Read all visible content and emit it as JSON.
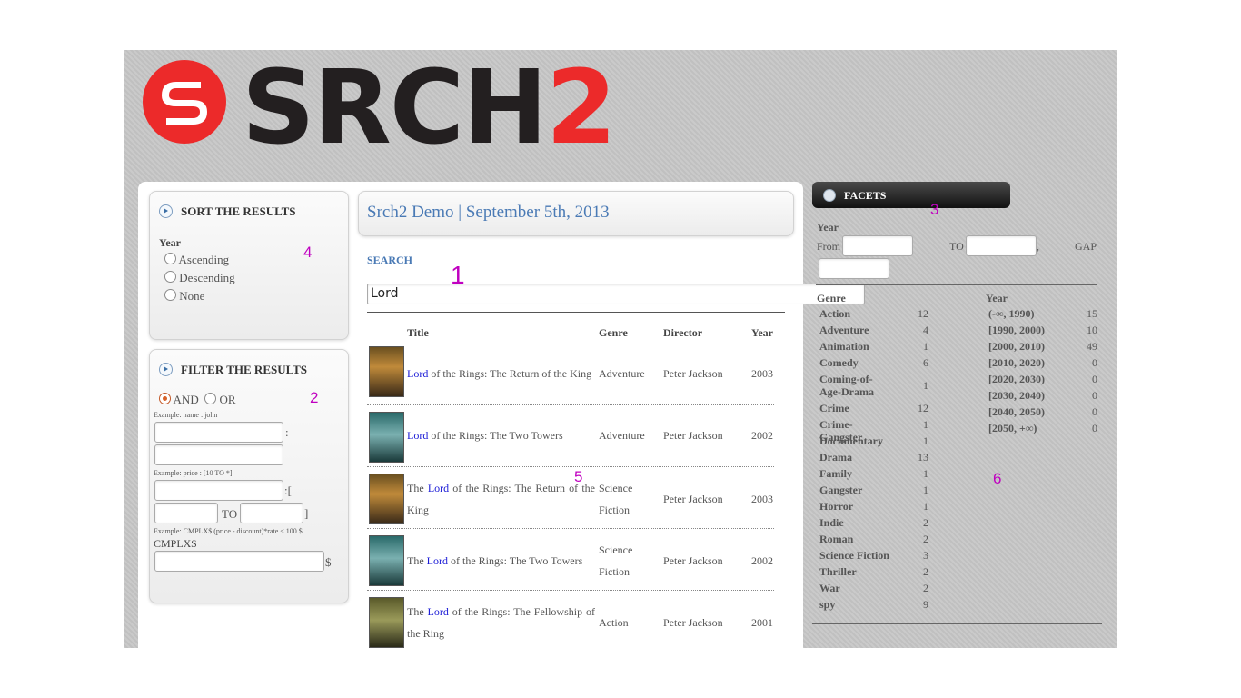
{
  "brand": {
    "logo_text": "SRCH",
    "logo_digit": "2",
    "colors": {
      "red": "#ec2a2a",
      "dark": "#231f20"
    }
  },
  "sort_panel": {
    "title": "SORT THE RESULTS",
    "field_label": "Year",
    "options": [
      "Ascending",
      "Descending",
      "None"
    ]
  },
  "filter_panel": {
    "title": "FILTER THE RESULTS",
    "and_label": "AND",
    "or_label": "OR",
    "example_name": "Example: name : john",
    "colon": ":",
    "example_price": "Example: price : [10 TO *]",
    "range_open": ":[",
    "to_label": "TO",
    "range_close": "]",
    "example_cmplx": "Example: CMPLX$ (price - discount)*rate < 100 $",
    "cmplx_label": "CMPLX$",
    "dollar": "$"
  },
  "main": {
    "header": "Srch2 Demo | September 5th, 2013",
    "search_label": "SEARCH",
    "search_value": "Lord"
  },
  "table": {
    "columns": [
      "Title",
      "Genre",
      "Director",
      "Year"
    ],
    "rows": [
      {
        "pre": "",
        "hl": "Lord",
        "post": " of the Rings: The Return of the King",
        "genre": "Adventure",
        "director": "Peter Jackson",
        "year": "2003"
      },
      {
        "pre": "",
        "hl": "Lord",
        "post": " of the Rings: The Two Towers",
        "genre": "Adventure",
        "director": "Peter Jackson",
        "year": "2002"
      },
      {
        "pre": "The ",
        "hl": "Lord",
        "post": " of the Rings: The Return of the King",
        "genre": "Science Fiction",
        "director": "Peter Jackson",
        "year": "2003"
      },
      {
        "pre": "The ",
        "hl": "Lord",
        "post": " of the Rings: The Two Towers",
        "genre": "Science Fiction",
        "director": "Peter Jackson",
        "year": "2002"
      },
      {
        "pre": "The ",
        "hl": "Lord",
        "post": " of the Rings: The Fellowship of the Ring",
        "genre": "Action",
        "director": "Peter Jackson",
        "year": "2001"
      }
    ]
  },
  "facets": {
    "title": "FACETS",
    "range": {
      "label": "Year",
      "from": "From",
      "to": "TO",
      "comma": ",",
      "gap": "GAP"
    },
    "genre_header": "Genre",
    "genres": [
      {
        "name": "Action",
        "count": "12"
      },
      {
        "name": "Adventure",
        "count": "4"
      },
      {
        "name": "Animation",
        "count": "1"
      },
      {
        "name": "Comedy",
        "count": "6"
      },
      {
        "name": "Coming-of-Age-Drama",
        "count": "1"
      },
      {
        "name": "Crime",
        "count": "12"
      },
      {
        "name": "Crime-Gangster",
        "count": "1"
      },
      {
        "name": "Documentary",
        "count": "1"
      },
      {
        "name": "Drama",
        "count": "13"
      },
      {
        "name": "Family",
        "count": "1"
      },
      {
        "name": "Gangster",
        "count": "1"
      },
      {
        "name": "Horror",
        "count": "1"
      },
      {
        "name": "Indie",
        "count": "2"
      },
      {
        "name": "Roman",
        "count": "2"
      },
      {
        "name": "Science Fiction",
        "count": "3"
      },
      {
        "name": "Thriller",
        "count": "2"
      },
      {
        "name": "War",
        "count": "2"
      },
      {
        "name": "spy",
        "count": "9"
      }
    ],
    "year_header": "Year",
    "years": [
      {
        "name": "(-∞, 1990)",
        "count": "15"
      },
      {
        "name": "[1990, 2000)",
        "count": "10"
      },
      {
        "name": "[2000, 2010)",
        "count": "49"
      },
      {
        "name": "[2010, 2020)",
        "count": "0"
      },
      {
        "name": "[2020, 2030)",
        "count": "0"
      },
      {
        "name": "[2030, 2040)",
        "count": "0"
      },
      {
        "name": "[2040, 2050)",
        "count": "0"
      },
      {
        "name": "[2050, +∞)",
        "count": "0"
      }
    ]
  },
  "annotations": [
    "1",
    "2",
    "3",
    "4",
    "5",
    "6"
  ]
}
